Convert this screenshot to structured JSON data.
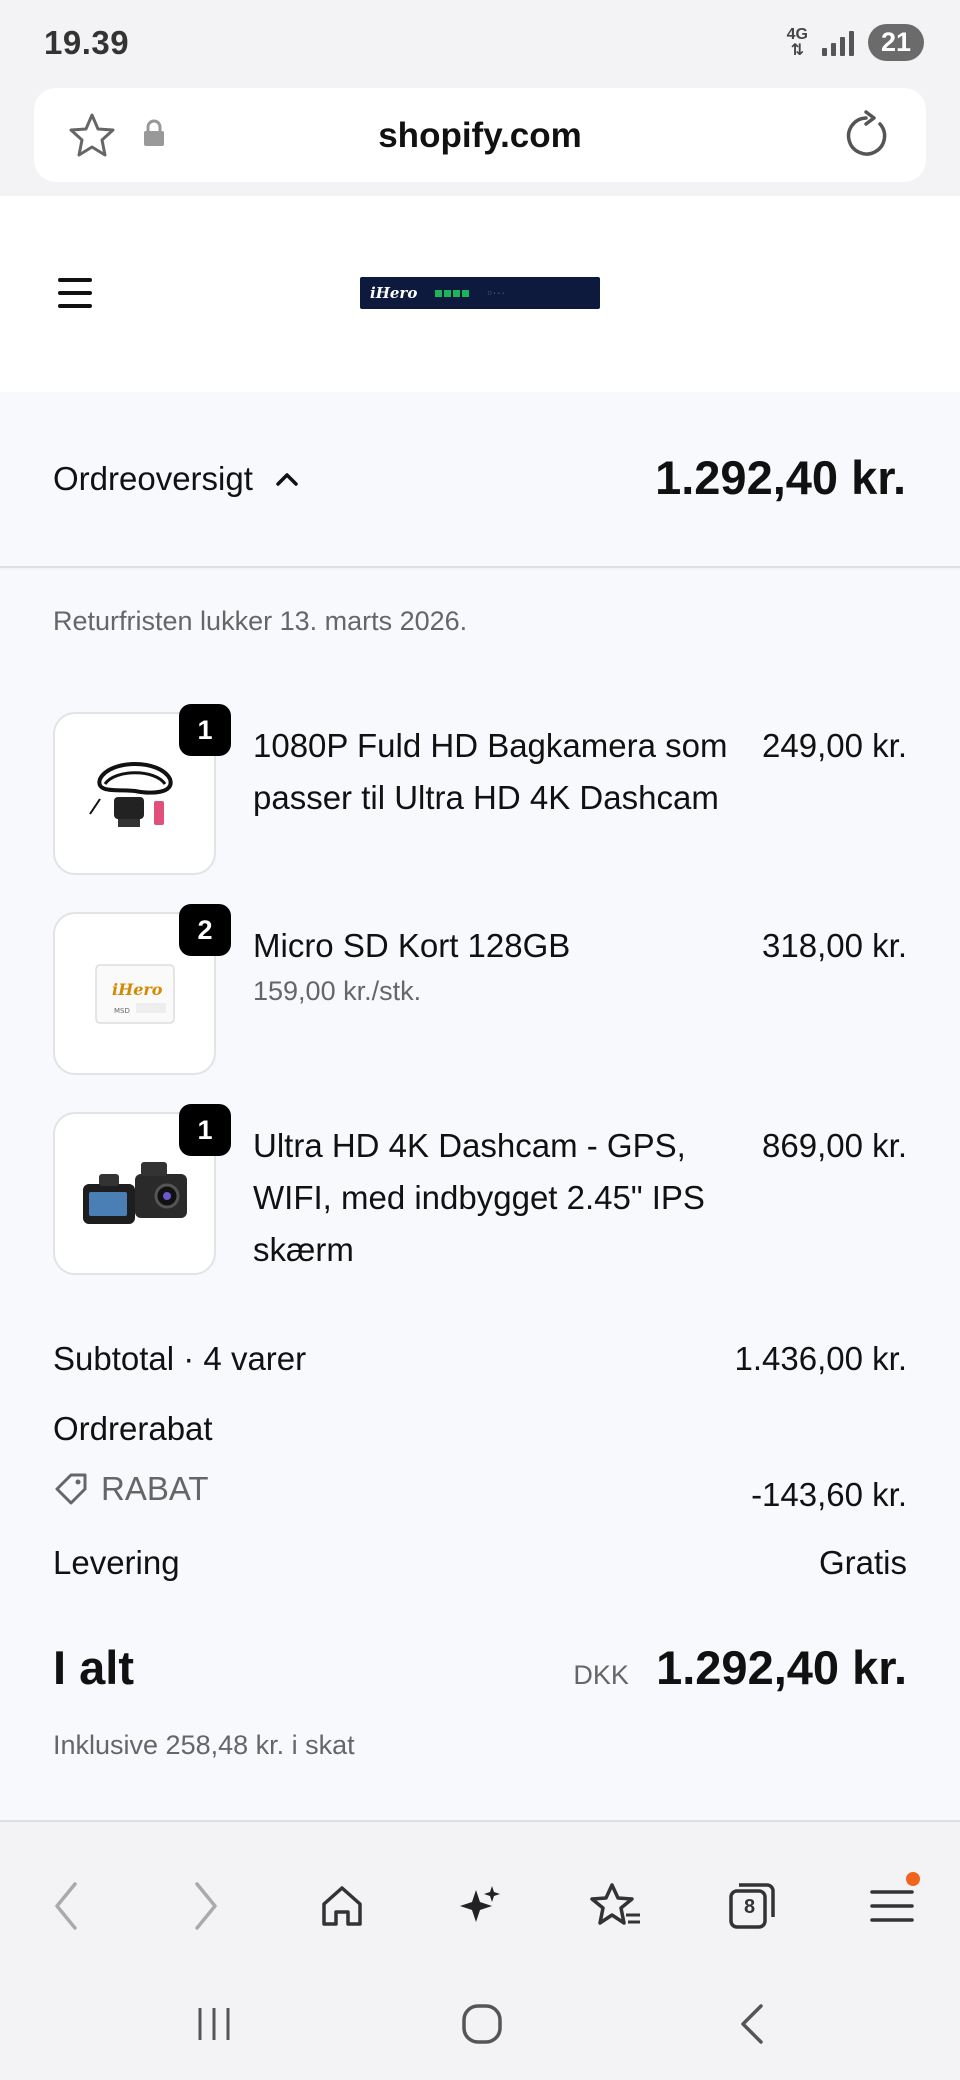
{
  "status": {
    "time": "19.39",
    "network": "4G",
    "battery": "21"
  },
  "browser": {
    "url": "shopify.com",
    "tabs_count": "8"
  },
  "store": {
    "logo_text": "iHero"
  },
  "summary": {
    "toggle_label": "Ordreoversigt",
    "total": "1.292,40 kr."
  },
  "return_note": "Returfristen lukker 13. marts 2026.",
  "items": [
    {
      "quantity": "1",
      "name": "1080P Fuld HD Bagkamera som passer til Ultra HD 4K Dashcam",
      "unit_price": "",
      "price": "249,00 kr."
    },
    {
      "quantity": "2",
      "name": "Micro SD Kort 128GB",
      "unit_price": "159,00 kr./stk.",
      "price": "318,00 kr."
    },
    {
      "quantity": "1",
      "name": "Ultra HD 4K Dashcam - GPS, WIFI, med indbygget 2.45\" IPS skærm",
      "unit_price": "",
      "price": "869,00 kr."
    }
  ],
  "totals": {
    "subtotal_label": "Subtotal · 4 varer",
    "subtotal_value": "1.436,00 kr.",
    "order_discount_label": "Ordrerabat",
    "discount_code": "RABAT",
    "discount_value": "-143,60 kr.",
    "shipping_label": "Levering",
    "shipping_value": "Gratis",
    "total_label": "I alt",
    "currency": "DKK",
    "total_value": "1.292,40 kr.",
    "tax_note": "Inklusive 258,48 kr. i skat"
  },
  "colors": {
    "accent_dot": "#f0641e",
    "logo_bg": "#0e1a3d"
  }
}
